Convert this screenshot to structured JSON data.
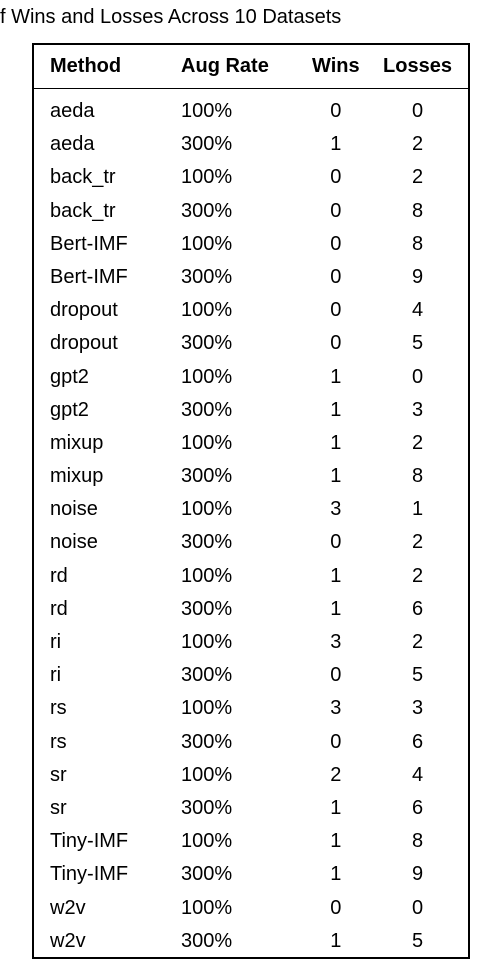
{
  "caption": "f Wins and Losses Across 10 Datasets",
  "headers": {
    "method": "Method",
    "aug_rate": "Aug Rate",
    "wins": "Wins",
    "losses": "Losses"
  },
  "chart_data": {
    "type": "table",
    "title": "f Wins and Losses Across 10 Datasets",
    "columns": [
      "Method",
      "Aug Rate",
      "Wins",
      "Losses"
    ],
    "rows": [
      {
        "method": "aeda",
        "aug_rate": "100%",
        "wins": 0,
        "losses": 0
      },
      {
        "method": "aeda",
        "aug_rate": "300%",
        "wins": 1,
        "losses": 2
      },
      {
        "method": "back_tr",
        "aug_rate": "100%",
        "wins": 0,
        "losses": 2
      },
      {
        "method": "back_tr",
        "aug_rate": "300%",
        "wins": 0,
        "losses": 8
      },
      {
        "method": "Bert-IMF",
        "aug_rate": "100%",
        "wins": 0,
        "losses": 8
      },
      {
        "method": "Bert-IMF",
        "aug_rate": "300%",
        "wins": 0,
        "losses": 9
      },
      {
        "method": "dropout",
        "aug_rate": "100%",
        "wins": 0,
        "losses": 4
      },
      {
        "method": "dropout",
        "aug_rate": "300%",
        "wins": 0,
        "losses": 5
      },
      {
        "method": "gpt2",
        "aug_rate": "100%",
        "wins": 1,
        "losses": 0
      },
      {
        "method": "gpt2",
        "aug_rate": "300%",
        "wins": 1,
        "losses": 3
      },
      {
        "method": "mixup",
        "aug_rate": "100%",
        "wins": 1,
        "losses": 2
      },
      {
        "method": "mixup",
        "aug_rate": "300%",
        "wins": 1,
        "losses": 8
      },
      {
        "method": "noise",
        "aug_rate": "100%",
        "wins": 3,
        "losses": 1
      },
      {
        "method": "noise",
        "aug_rate": "300%",
        "wins": 0,
        "losses": 2
      },
      {
        "method": "rd",
        "aug_rate": "100%",
        "wins": 1,
        "losses": 2
      },
      {
        "method": "rd",
        "aug_rate": "300%",
        "wins": 1,
        "losses": 6
      },
      {
        "method": "ri",
        "aug_rate": "100%",
        "wins": 3,
        "losses": 2
      },
      {
        "method": "ri",
        "aug_rate": "300%",
        "wins": 0,
        "losses": 5
      },
      {
        "method": "rs",
        "aug_rate": "100%",
        "wins": 3,
        "losses": 3
      },
      {
        "method": "rs",
        "aug_rate": "300%",
        "wins": 0,
        "losses": 6
      },
      {
        "method": "sr",
        "aug_rate": "100%",
        "wins": 2,
        "losses": 4
      },
      {
        "method": "sr",
        "aug_rate": "300%",
        "wins": 1,
        "losses": 6
      },
      {
        "method": "Tiny-IMF",
        "aug_rate": "100%",
        "wins": 1,
        "losses": 8
      },
      {
        "method": "Tiny-IMF",
        "aug_rate": "300%",
        "wins": 1,
        "losses": 9
      },
      {
        "method": "w2v",
        "aug_rate": "100%",
        "wins": 0,
        "losses": 0
      },
      {
        "method": "w2v",
        "aug_rate": "300%",
        "wins": 1,
        "losses": 5
      }
    ]
  }
}
